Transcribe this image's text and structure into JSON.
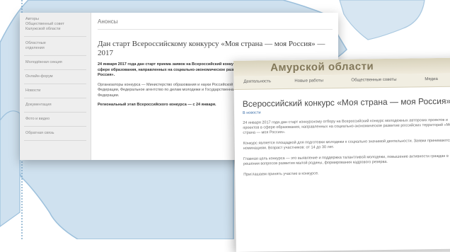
{
  "colors": {
    "map_fill": "#cfe1ef",
    "map_stroke": "#9cc0dc",
    "background": "#ffffff"
  },
  "left_window": {
    "sidebar_items": [
      "Авторы\nОбщественный совет\nКалужской области",
      "Областные\nотделения",
      "Молодёжная секция",
      "Онлайн-форум",
      "Новости",
      "Документация",
      "Фото и видео",
      "Обратная связь"
    ],
    "breadcrumb": "Анонсы",
    "article_title": "Дан старт Всероссийскому конкурсу «Моя страна — моя Россия» — 2017",
    "paragraphs": [
      "24 января 2017 года дан старт приема заявок на Всероссийский конкурс молодежных авторских проектов и проектов в сфере образования, направленных на социально-экономическое развитие российских территорий «Моя страна — моя Россия».",
      "Организаторы конкурса — Министерство образования и науки Российской Федерации, Общественная палата Российской Федерации, Федеральное агентство по делам молодежи и Государственная Дума Федерального Собрания Российской Федерации.",
      "Региональный этап Всероссийского конкурса — с 24 января."
    ]
  },
  "right_window": {
    "site_title": "Амурской области",
    "nav": [
      "Деятельность",
      "Новые работы",
      "Общественные советы",
      "Медиа"
    ],
    "article_title": "Всероссийский конкурс «Моя страна — моя Россия»",
    "link": "В новости",
    "paragraphs": [
      "24 января 2017 года дан старт конкурсному отбору на Всероссийский конкурс молодежных авторских проектов и проектов в сфере образования, направленных на социально-экономическое развитие российских территорий «Моя страна — моя Россия».",
      "Конкурс является площадкой для подготовки молодежи к социально значимой деятельности. Заявки принимаются по номинациям. Возраст участников: от 14 до 30 лет.",
      "Главная цель конкурса — это выявление и поддержка талантливой молодежи, повышение активности граждан в решении вопросов развития малой родины, формирования кадрового резерва.",
      "Приглашаем принять участие в конкурсе."
    ]
  }
}
